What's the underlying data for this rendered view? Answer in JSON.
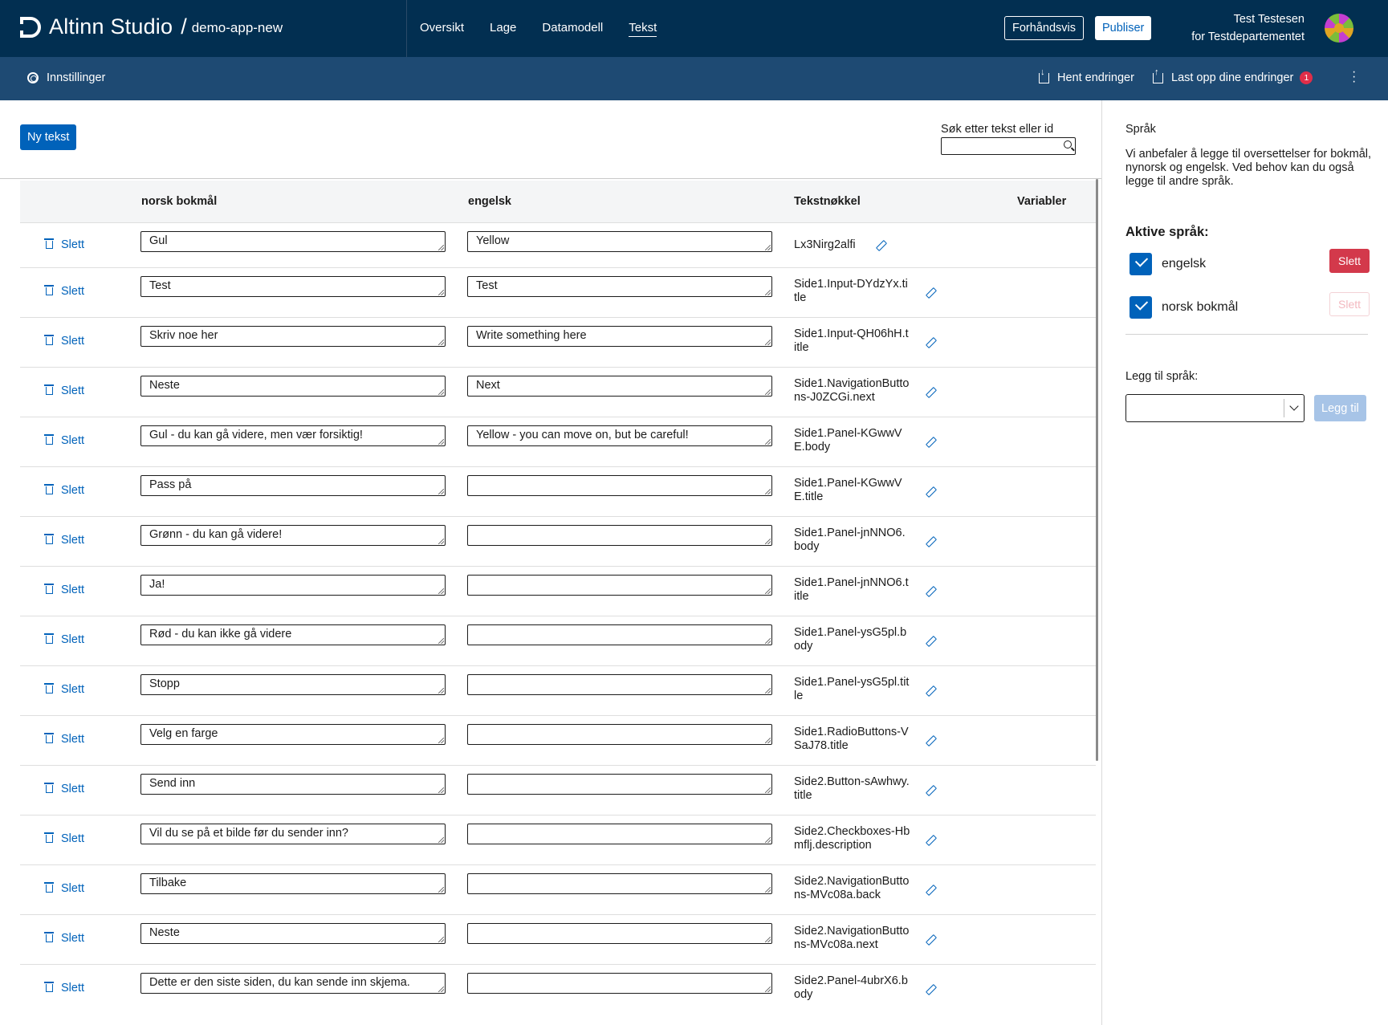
{
  "header": {
    "brand": "Altinn Studio",
    "app_name": "demo-app-new",
    "nav": [
      "Oversikt",
      "Lage",
      "Datamodell",
      "Tekst"
    ],
    "active_nav": "Tekst",
    "preview_label": "Forhåndsvis",
    "publish_label": "Publiser",
    "user_name": "Test Testesen",
    "user_org": "for Testdepartementet"
  },
  "subbar": {
    "settings_label": "Innstillinger",
    "fetch_label": "Hent endringer",
    "upload_label": "Last opp dine endringer",
    "upload_badge": "1"
  },
  "main": {
    "new_text_label": "Ny tekst",
    "search_label": "Søk etter tekst eller id",
    "search_value": "",
    "columns": [
      "norsk bokmål",
      "engelsk",
      "Tekstnøkkel",
      "Variabler"
    ],
    "delete_label": "Slett",
    "rows": [
      {
        "nb": "Gul",
        "en": "Yellow",
        "key": "Lx3Nirg2alfi"
      },
      {
        "nb": "Test",
        "en": "Test",
        "key": "Side1.Input-DYdzYx.title"
      },
      {
        "nb": "Skriv noe her",
        "en": "Write something here",
        "key": "Side1.Input-QH06hH.title"
      },
      {
        "nb": "Neste",
        "en": "Next",
        "key": "Side1.NavigationButtons-J0ZCGi.next"
      },
      {
        "nb": "Gul - du kan gå videre, men vær forsiktig!",
        "en": "Yellow - you can move on, but be careful!",
        "key": "Side1.Panel-KGwwVE.body"
      },
      {
        "nb": "Pass på",
        "en": "",
        "key": "Side1.Panel-KGwwVE.title"
      },
      {
        "nb": "Grønn - du kan gå videre!",
        "en": "",
        "key": "Side1.Panel-jnNNO6.body"
      },
      {
        "nb": "Ja!",
        "en": "",
        "key": "Side1.Panel-jnNNO6.title"
      },
      {
        "nb": "Rød - du kan ikke gå videre",
        "en": "",
        "key": "Side1.Panel-ysG5pl.body"
      },
      {
        "nb": "Stopp",
        "en": "",
        "key": "Side1.Panel-ysG5pl.title"
      },
      {
        "nb": "Velg en farge",
        "en": "",
        "key": "Side1.RadioButtons-VSaJ78.title"
      },
      {
        "nb": "Send inn",
        "en": "",
        "key": "Side2.Button-sAwhwy.title"
      },
      {
        "nb": "Vil du se på et bilde før du sender inn?",
        "en": "",
        "key": "Side2.Checkboxes-Hbmflj.description"
      },
      {
        "nb": "Tilbake",
        "en": "",
        "key": "Side2.NavigationButtons-MVc08a.back"
      },
      {
        "nb": "Neste",
        "en": "",
        "key": "Side2.NavigationButtons-MVc08a.next"
      },
      {
        "nb": "Dette er den siste siden, du kan sende inn skjema.",
        "en": "",
        "key": "Side2.Panel-4ubrX6.body"
      }
    ]
  },
  "sidebar": {
    "title": "Språk",
    "description": "Vi anbefaler å legge til oversettelser for bokmål, nynorsk og engelsk. Ved behov kan du også legge til andre språk.",
    "active_title": "Aktive språk:",
    "languages": [
      {
        "name": "engelsk",
        "delete_label": "Slett",
        "delete_enabled": true
      },
      {
        "name": "norsk bokmål",
        "delete_label": "Slett",
        "delete_enabled": false
      }
    ],
    "add_title": "Legg til språk:",
    "select_value": "",
    "add_button_label": "Legg til"
  },
  "colors": {
    "header_bg": "#022f51",
    "subbar_bg": "#1e4a73",
    "primary": "#0062ba",
    "danger": "#d3394b"
  }
}
